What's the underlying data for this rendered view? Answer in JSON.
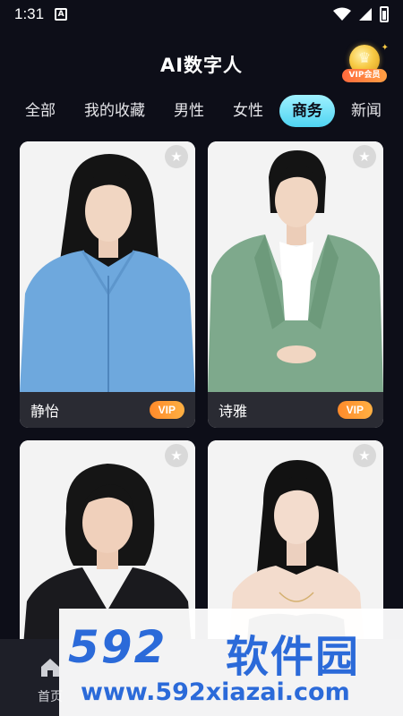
{
  "status_bar": {
    "time": "1:31",
    "notification_icon": "A"
  },
  "header": {
    "title": "AI数字人",
    "vip_badge": "VIP会员"
  },
  "tabs": [
    {
      "label": "全部",
      "active": false
    },
    {
      "label": "我的收藏",
      "active": false
    },
    {
      "label": "男性",
      "active": false
    },
    {
      "label": "女性",
      "active": false
    },
    {
      "label": "商务",
      "active": true
    },
    {
      "label": "新闻",
      "active": false
    }
  ],
  "cards": [
    {
      "name": "静怡",
      "vip": "VIP",
      "outfit": "#6ea8dd"
    },
    {
      "name": "诗雅",
      "vip": "VIP",
      "outfit": "#7ea98c"
    },
    {
      "name": "",
      "vip": "",
      "outfit": "#1a1a1e"
    },
    {
      "name": "",
      "vip": "",
      "outfit": "#141416"
    }
  ],
  "bottom_nav": {
    "home_label": "首页"
  },
  "watermark": {
    "logo_num": "592",
    "logo_text": "软件园",
    "url": "www.592xiazai.com"
  },
  "colors": {
    "background": "#0d0e18",
    "active_tab": "#4fd4f2",
    "vip_tag": "#ff9a36",
    "card_footer": "#2a2b33",
    "watermark": "#2b6ad9"
  }
}
